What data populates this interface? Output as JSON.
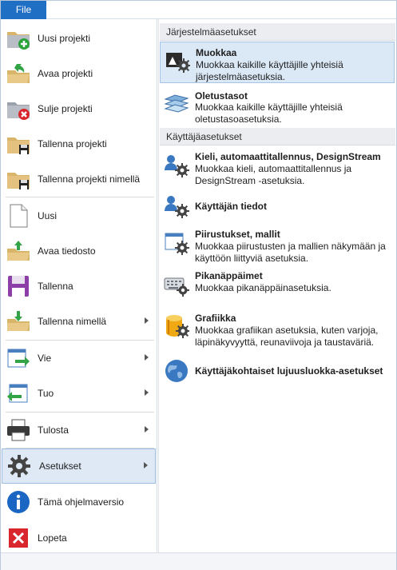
{
  "menubar": {
    "file_label": "File"
  },
  "left_menu": [
    {
      "label": "Uusi projekti",
      "icon": "new-project-icon"
    },
    {
      "label": "Avaa projekti",
      "icon": "open-project-icon"
    },
    {
      "label": "Sulje projekti",
      "icon": "close-project-icon"
    },
    {
      "label": "Tallenna projekti",
      "icon": "save-project-icon"
    },
    {
      "label": "Tallenna projekti nimellä",
      "icon": "save-project-as-icon"
    },
    {
      "label": "Uusi",
      "icon": "new-file-icon"
    },
    {
      "label": "Avaa tiedosto",
      "icon": "open-file-icon"
    },
    {
      "label": "Tallenna",
      "icon": "save-icon"
    },
    {
      "label": "Tallenna nimellä",
      "icon": "save-as-icon",
      "submenu": true
    },
    {
      "label": "Vie",
      "icon": "export-icon",
      "submenu": true
    },
    {
      "label": "Tuo",
      "icon": "import-icon",
      "submenu": true
    },
    {
      "label": "Tulosta",
      "icon": "print-icon",
      "submenu": true
    },
    {
      "label": "Asetukset",
      "icon": "settings-gear-icon",
      "submenu": true,
      "active": true
    },
    {
      "label": "Tämä ohjelmaversio",
      "icon": "info-icon"
    },
    {
      "label": "Lopeta",
      "icon": "exit-icon"
    }
  ],
  "right_panel": {
    "section_system": "Järjestelmäasetukset",
    "section_user": "Käyttäjäasetukset",
    "options": [
      {
        "title": "Muokkaa",
        "desc": "Muokkaa kaikille käyttäjille yhteisiä järjestelmäasetuksia.",
        "icon": "system-edit-icon",
        "highlighted": true
      },
      {
        "title": "Oletustasot",
        "desc": "Muokkaa kaikille käyttäjille yhteisiä oletustasoasetuksia.",
        "icon": "default-levels-icon"
      },
      {
        "title": "Kieli, automaattitallennus, DesignStream",
        "desc": "Muokkaa kieli, automaattitallennus ja DesignStream -asetuksia.",
        "icon": "user-settings-icon"
      },
      {
        "title": "Käyttäjän tiedot",
        "desc": "",
        "icon": "user-info-icon"
      },
      {
        "title": "Piirustukset, mallit",
        "desc": "Muokkaa piirustusten ja mallien näkymään ja käyttöön liittyviä asetuksia.",
        "icon": "drawings-models-icon"
      },
      {
        "title": "Pikanäppäimet",
        "desc": "Muokkaa pikanäppäinasetuksia.",
        "icon": "keyboard-shortcuts-icon"
      },
      {
        "title": "Grafiikka",
        "desc": "Muokkaa grafiikan asetuksia, kuten varjoja, läpinäkyvyyttä, reunaviivoja ja taustaväriä.",
        "icon": "graphics-icon"
      },
      {
        "title": "Käyttäjäkohtaiset lujuusluokka-asetukset",
        "desc": "",
        "icon": "strength-class-globe-icon"
      }
    ]
  },
  "colors": {
    "file_tab": "#1f6fc5",
    "active_item": "#dfe9f5",
    "section_bg": "#ebedf0"
  }
}
